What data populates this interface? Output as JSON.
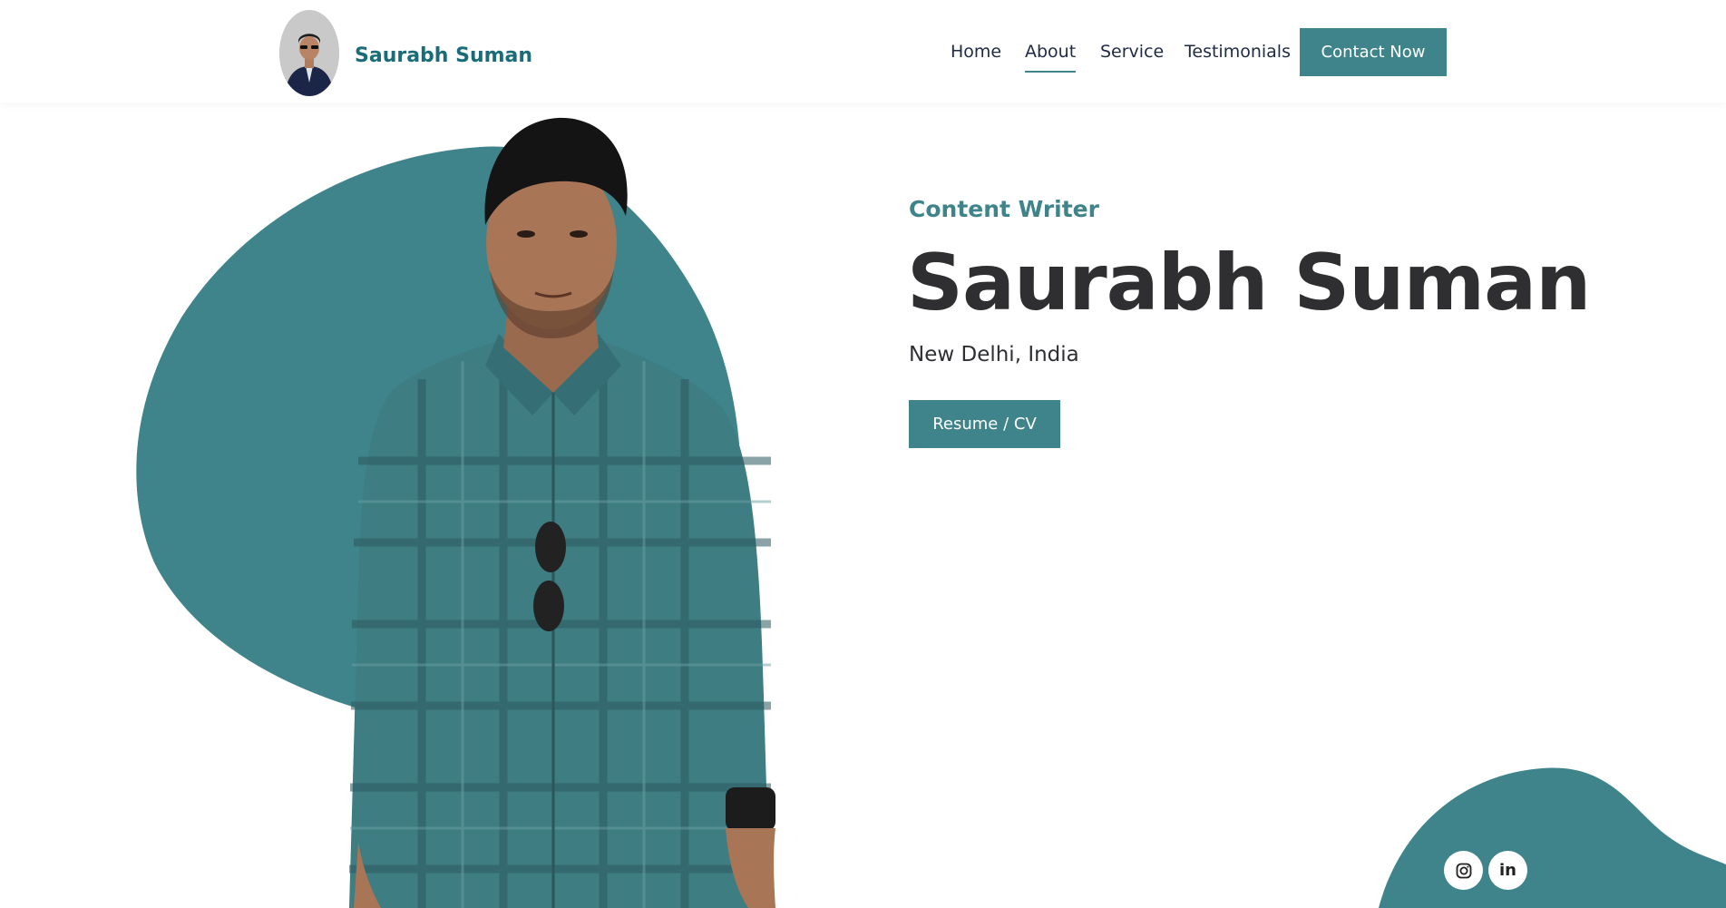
{
  "header": {
    "brand": "Saurabh Suman",
    "nav": [
      {
        "label": "Home"
      },
      {
        "label": "About"
      },
      {
        "label": "Service"
      },
      {
        "label": "Testimonials"
      }
    ],
    "contact_label": "Contact Now"
  },
  "hero": {
    "role": "Content Writer",
    "name": "Saurabh Suman",
    "location": "New Delhi, India",
    "resume_label": "Resume / CV"
  },
  "social": {
    "linkedin_label": "in"
  },
  "colors": {
    "accent": "#3e848a",
    "brand_text": "#1a6d78",
    "heading": "#2f2f31"
  }
}
